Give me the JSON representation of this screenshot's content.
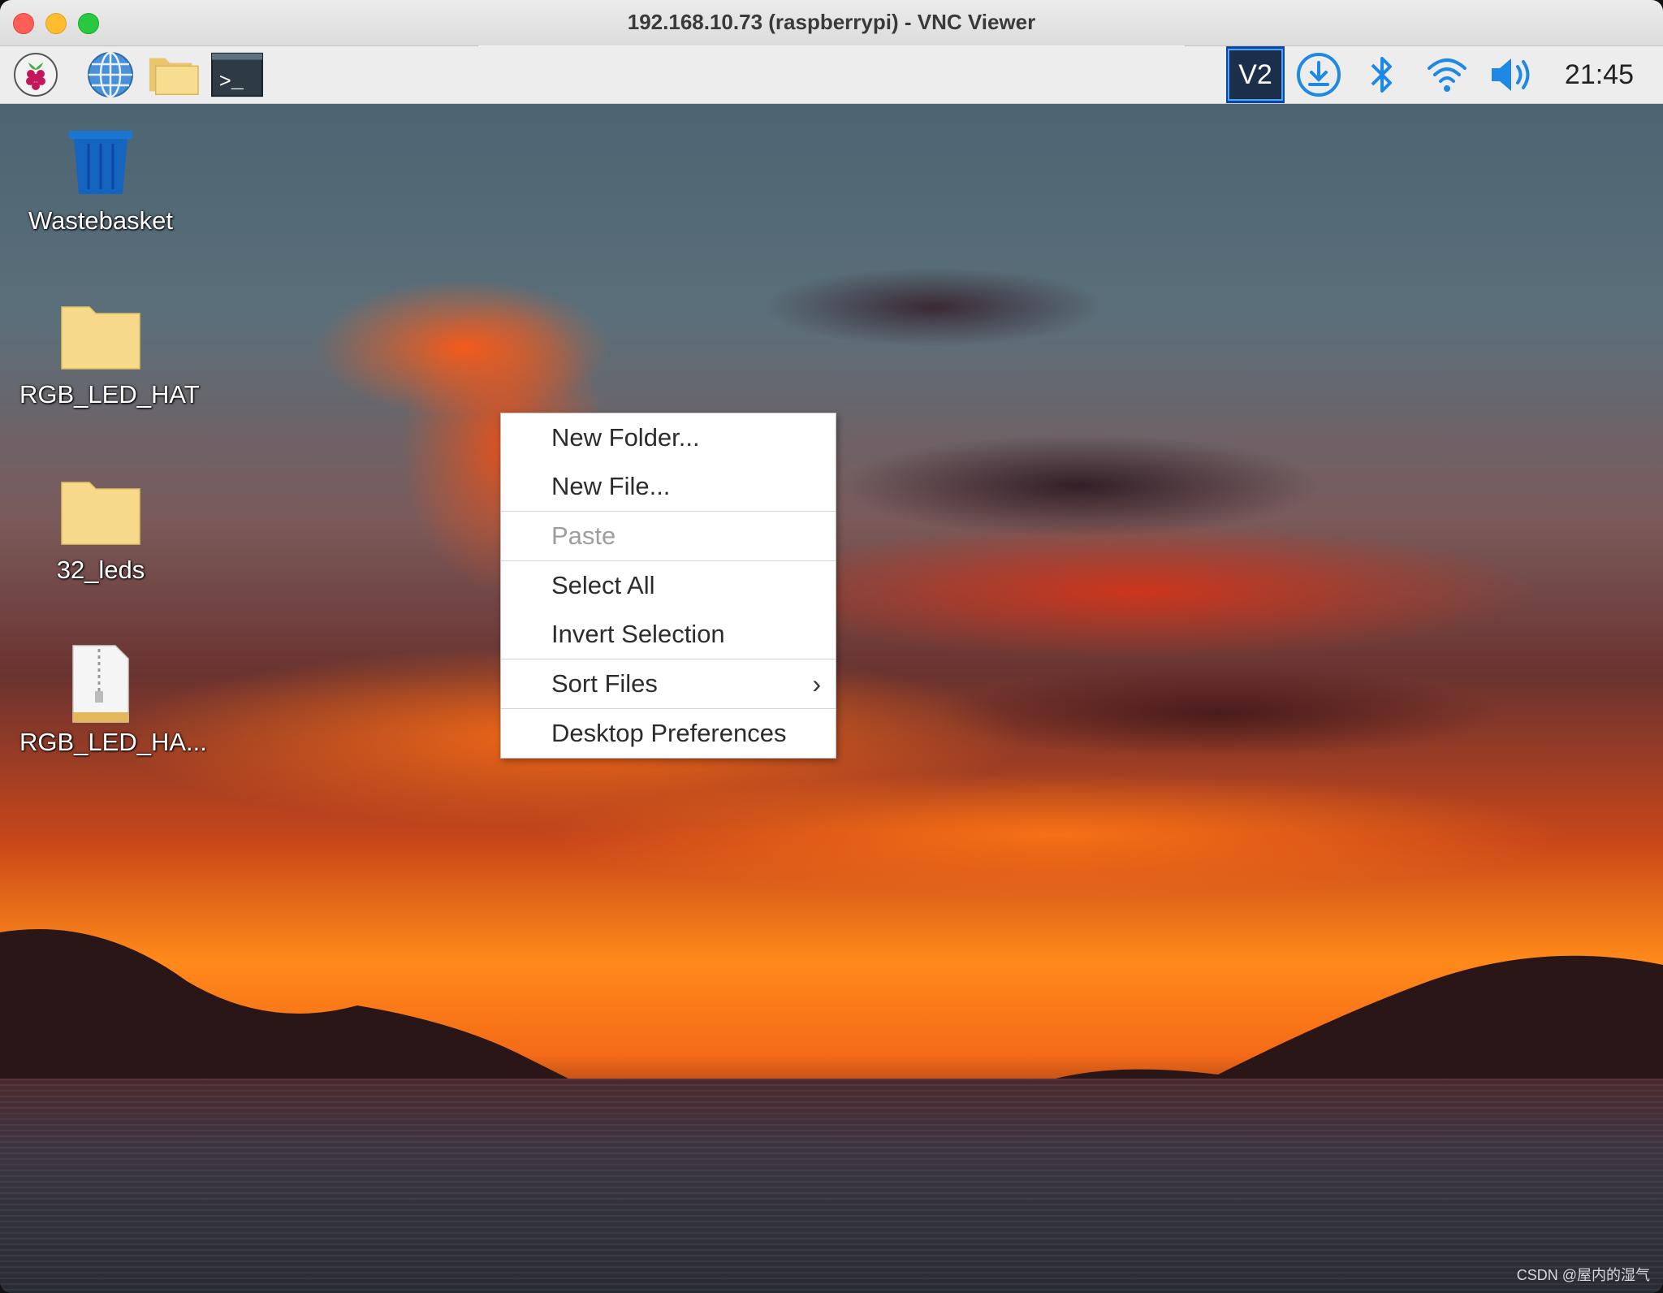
{
  "window": {
    "title": "192.168.10.73 (raspberrypi) - VNC Viewer",
    "traffic_lights": [
      "close",
      "minimize",
      "zoom"
    ]
  },
  "panel": {
    "launchers": [
      {
        "name": "raspberry-menu-icon"
      },
      {
        "name": "web-browser-icon"
      },
      {
        "name": "file-manager-icon"
      },
      {
        "name": "terminal-icon"
      }
    ],
    "tray": [
      {
        "name": "vnc-server-icon"
      },
      {
        "name": "download-updates-icon"
      },
      {
        "name": "bluetooth-icon"
      },
      {
        "name": "wifi-icon"
      },
      {
        "name": "volume-icon"
      }
    ],
    "clock": "21:45",
    "terminal_glyph": ">_",
    "vnc_glyph": "V2"
  },
  "desktop": {
    "icons": [
      {
        "label": "Wastebasket",
        "type": "trash"
      },
      {
        "label": "RGB_LED_HAT",
        "type": "folder"
      },
      {
        "label": "32_leds",
        "type": "folder"
      },
      {
        "label": "RGB_LED_HA...",
        "type": "archive"
      }
    ]
  },
  "context_menu": {
    "items": [
      {
        "label": "New Folder...",
        "enabled": true
      },
      {
        "label": "New File...",
        "enabled": true
      },
      {
        "label": "Paste",
        "enabled": false
      },
      {
        "label": "Select All",
        "enabled": true
      },
      {
        "label": "Invert Selection",
        "enabled": true
      },
      {
        "label": "Sort Files",
        "enabled": true,
        "submenu": true
      },
      {
        "label": "Desktop Preferences",
        "enabled": true
      }
    ],
    "submenu_glyph": "›"
  },
  "watermark": "CSDN @屋内的湿气",
  "colors": {
    "panel_bg": "#ededed",
    "accent": "#1e88e5",
    "folder": "#f6d98a",
    "trash": "#1565c0"
  }
}
